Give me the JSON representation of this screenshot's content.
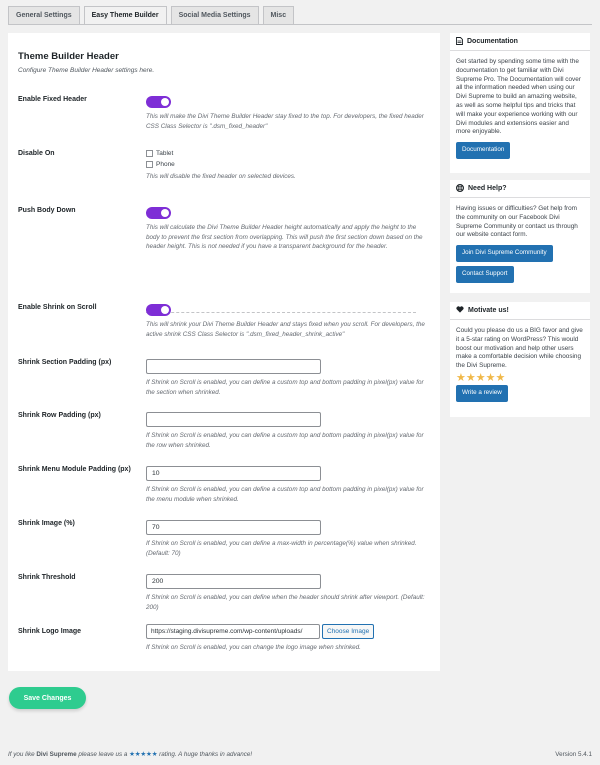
{
  "tabs": [
    {
      "label": "General Settings"
    },
    {
      "label": "Easy Theme Builder"
    },
    {
      "label": "Social Media Settings"
    },
    {
      "label": "Misc"
    }
  ],
  "main": {
    "title": "Theme Builder Header",
    "subtitle": "Configure Theme Builder Header settings here.",
    "fixed_header": {
      "label": "Enable Fixed Header",
      "enabled": true,
      "desc": "This will make the Divi Theme Builder Header stay fixed to the top. For developers, the fixed header CSS Class Selector is \".dsm_fixed_header\""
    },
    "disable_on": {
      "label": "Disable On",
      "options": [
        "Tablet",
        "Phone"
      ],
      "desc": "This will disable the fixed header on selected devices."
    },
    "push_body": {
      "label": "Push Body Down",
      "enabled": true,
      "desc": "This will calculate the Divi Theme Builder Header height automatically and apply the height to the body to prevent the first section from overlapping. This will push the first section down based on the header height. This is not needed if you have a transparent background for the header."
    },
    "shrink_scroll": {
      "label": "Enable Shrink on Scroll",
      "enabled": true,
      "desc": "This will shrink your Divi Theme Builder Header and stays fixed when you scroll. For developers, the active shrink CSS Class Selector is \".dsm_fixed_header_shrink_active\""
    },
    "section_padding": {
      "label": "Shrink Section Padding (px)",
      "value": "",
      "desc": "If Shrink on Scroll is enabled, you can define a custom top and bottom padding in pixel(px) value for the section when shrinked."
    },
    "row_padding": {
      "label": "Shrink Row Padding (px)",
      "value": "",
      "desc": "If Shrink on Scroll is enabled, you can define a custom top and bottom padding in pixel(px) value for the row when shrinked."
    },
    "menu_padding": {
      "label": "Shrink Menu Module Padding (px)",
      "value": "10",
      "desc": "If Shrink on Scroll is enabled, you can define a custom top and bottom padding in pixel(px) value for the menu module when shrinked."
    },
    "shrink_image": {
      "label": "Shrink Image (%)",
      "value": "70",
      "desc": "If Shrink on Scroll is enabled, you can define a max-width in percentage(%) value when shrinked. (Default: 70)"
    },
    "shrink_threshold": {
      "label": "Shrink Threshold",
      "value": "200",
      "desc": "If Shrink on Scroll is enabled, you can define when the header should shrink after viewport. (Default: 200)"
    },
    "shrink_logo": {
      "label": "Shrink Logo Image",
      "value": "https://staging.divisupreme.com/wp-content/uploads/",
      "button": "Choose Image",
      "desc": "If Shrink on Scroll is enabled, you can change the logo image when shrinked."
    }
  },
  "save_button": "Save Changes",
  "sidebar": {
    "documentation": {
      "title": "Documentation",
      "body": "Get started by spending some time with the documentation to get familiar with Divi Supreme Pro. The Documentation will cover all the information needed when using our Divi Supreme to build an amazing website, as well as some helpful tips and tricks that will make your experience working with our Divi modules and extensions easier and more enjoyable.",
      "button": "Documentation"
    },
    "help": {
      "title": "Need Help?",
      "body": "Having issues or difficulties? Get help from the community on our Facebook Divi Supreme Community or contact us through our website contact form.",
      "button1": "Join Divi Supreme Community",
      "button2": "Contact Support"
    },
    "motivate": {
      "title": "Motivate us!",
      "body": "Could you please do us a BIG favor and give it a 5-star rating on WordPress? This would boost our motivation and help other users make a comfortable decision while choosing the Divi Supreme.",
      "stars": "★★★★★",
      "button": "Write a review"
    }
  },
  "footer": {
    "left_prefix": "If you like",
    "left_brand": "Divi Supreme",
    "left_mid": "please leave us a",
    "left_stars": "★★★★★",
    "left_suffix": "rating. A huge thanks in advance!",
    "version": "Version 5.4.1"
  },
  "colors": {
    "toggle": "#7e2ed6",
    "save": "#2ecc8f",
    "primary": "#2271b1",
    "star": "#f0b849"
  }
}
